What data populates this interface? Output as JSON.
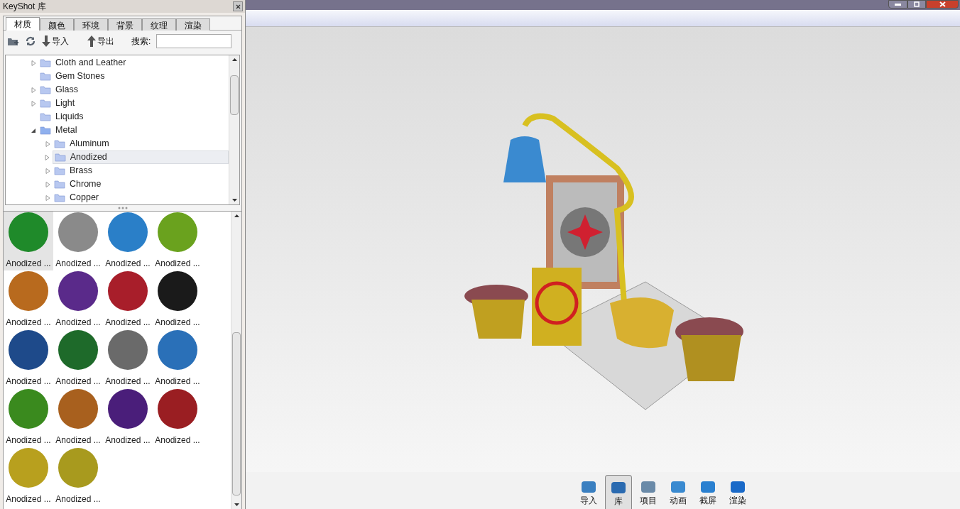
{
  "panel": {
    "title": "KeyShot 库",
    "tabs": [
      {
        "label": "材质",
        "selected": true
      },
      {
        "label": "颜色",
        "selected": false
      },
      {
        "label": "环境",
        "selected": false
      },
      {
        "label": "背景",
        "selected": false
      },
      {
        "label": "纹理",
        "selected": false
      },
      {
        "label": "渲染",
        "selected": false
      }
    ],
    "toolbar": {
      "import": "导入",
      "export": "导出",
      "search_label": "搜索:"
    },
    "tree": [
      {
        "label": "Cloth and Leather",
        "expandable": true,
        "expanded": false,
        "selected": false
      },
      {
        "label": "Gem Stones",
        "expandable": false,
        "expanded": false,
        "selected": false
      },
      {
        "label": "Glass",
        "expandable": true,
        "expanded": false,
        "selected": false
      },
      {
        "label": "Light",
        "expandable": true,
        "expanded": false,
        "selected": false
      },
      {
        "label": "Liquids",
        "expandable": false,
        "expanded": false,
        "selected": false
      },
      {
        "label": "Metal",
        "expandable": true,
        "expanded": true,
        "selected": false,
        "children": [
          {
            "label": "Aluminum",
            "expandable": true,
            "expanded": false,
            "selected": false
          },
          {
            "label": "Anodized",
            "expandable": true,
            "expanded": false,
            "selected": true
          },
          {
            "label": "Brass",
            "expandable": true,
            "expanded": false,
            "selected": false
          },
          {
            "label": "Chrome",
            "expandable": true,
            "expanded": false,
            "selected": false
          },
          {
            "label": "Copper",
            "expandable": true,
            "expanded": false,
            "selected": false
          }
        ]
      }
    ],
    "materials": [
      {
        "label": "Anodized ...",
        "color": "#1f8a2a",
        "selected": true
      },
      {
        "label": "Anodized ...",
        "color": "#8a8a8a",
        "selected": false
      },
      {
        "label": "Anodized ...",
        "color": "#2a7fc8",
        "selected": false
      },
      {
        "label": "Anodized ...",
        "color": "#6aa21e",
        "selected": false
      },
      {
        "label": "Anodized ...",
        "color": "#b86a1e",
        "selected": false
      },
      {
        "label": "Anodized ...",
        "color": "#5a2a8a",
        "selected": false
      },
      {
        "label": "Anodized ...",
        "color": "#a81e2a",
        "selected": false
      },
      {
        "label": "Anodized ...",
        "color": "#1a1a1a",
        "selected": false
      },
      {
        "label": "Anodized ...",
        "color": "#1e4a8a",
        "selected": false
      },
      {
        "label": "Anodized ...",
        "color": "#1e6a2a",
        "selected": false
      },
      {
        "label": "Anodized ...",
        "color": "#6a6a6a",
        "selected": false
      },
      {
        "label": "Anodized ...",
        "color": "#2a70b8",
        "selected": false
      },
      {
        "label": "Anodized ...",
        "color": "#3a8a1e",
        "selected": false
      },
      {
        "label": "Anodized ...",
        "color": "#a8601e",
        "selected": false
      },
      {
        "label": "Anodized ...",
        "color": "#4a1e7a",
        "selected": false
      },
      {
        "label": "Anodized ...",
        "color": "#9a1e22",
        "selected": false
      },
      {
        "label": "Anodized ...",
        "color": "#b8a01e",
        "selected": false
      },
      {
        "label": "Anodized ...",
        "color": "#a89a1e",
        "selected": false
      }
    ]
  },
  "bottom_toolbar": [
    {
      "label": "导入",
      "selected": false
    },
    {
      "label": "库",
      "selected": true
    },
    {
      "label": "项目",
      "selected": false
    },
    {
      "label": "动画",
      "selected": false
    },
    {
      "label": "截屏",
      "selected": false
    },
    {
      "label": "渲染",
      "selected": false
    }
  ]
}
